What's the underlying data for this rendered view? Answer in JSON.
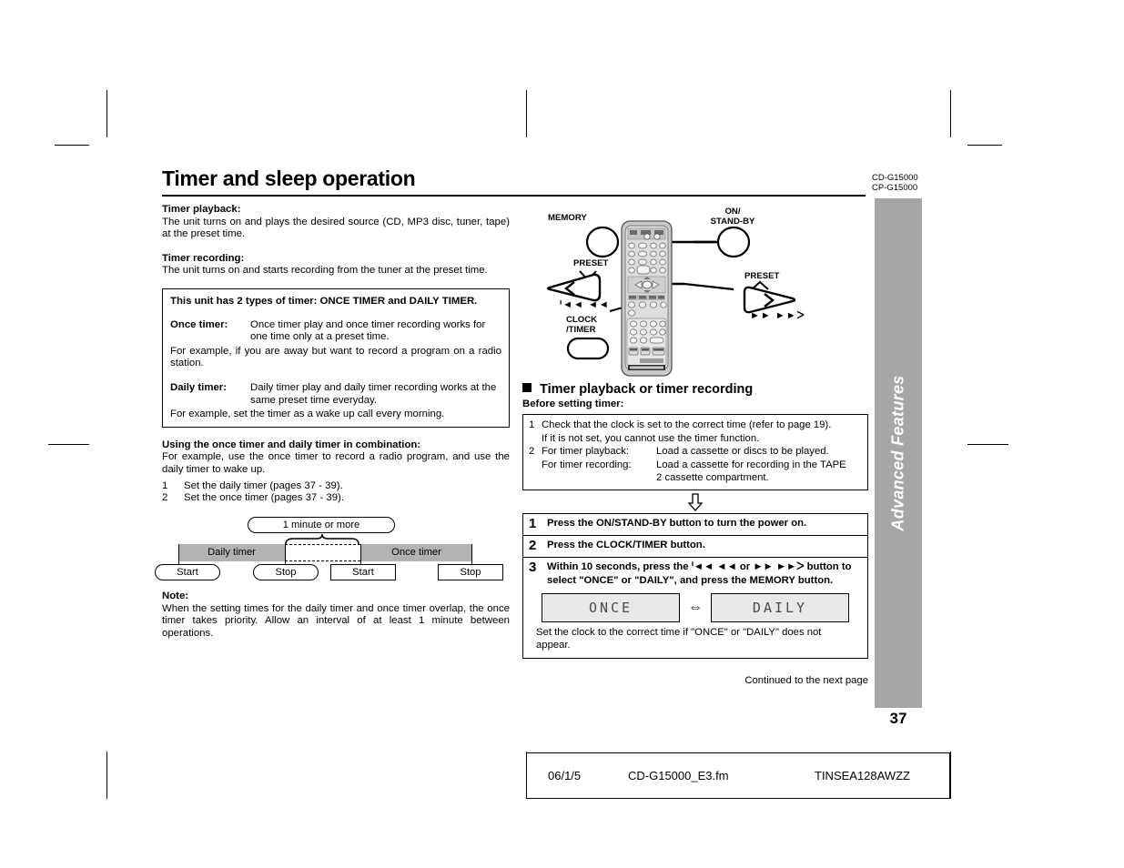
{
  "header": {
    "title": "Timer and sleep operation",
    "model_lines": [
      "CD-G15000",
      "CP-G15000"
    ]
  },
  "left": {
    "timer_playback_head": "Timer playback:",
    "timer_playback_body": "The unit turns on and plays the desired source (CD, MP3 disc, tuner, tape) at the preset time.",
    "timer_recording_head": "Timer recording:",
    "timer_recording_body": "The unit turns on and starts recording from the tuner at the preset time.",
    "panel": {
      "heading": "This unit has 2 types of timer: ONCE TIMER and DAILY TIMER.",
      "once_term": "Once timer:",
      "once_body": "Once timer play and once timer recording works for one time only at a preset time.",
      "once_example": "For example, if you are away but want to record a program on a radio station.",
      "daily_term": "Daily timer:",
      "daily_body": "Daily timer play and daily timer recording works at the same preset time everyday.",
      "daily_example": "For example, set the timer as a wake up call every morning."
    },
    "combination": {
      "heading": "Using the once timer and daily timer in combination:",
      "body": "For example, use the once timer to record a radio program, and use the daily timer to wake up.",
      "items": [
        {
          "n": "1",
          "text": "Set the daily timer (pages 37 - 39)."
        },
        {
          "n": "2",
          "text": "Set the once timer (pages 37 - 39)."
        }
      ]
    },
    "timeline": {
      "gap_label": "1 minute or more",
      "daily_label": "Daily timer",
      "once_label": "Once timer",
      "daily_start": "Start",
      "daily_stop": "Stop",
      "once_start": "Start",
      "once_stop": "Stop"
    },
    "note": {
      "heading": "Note:",
      "body": "When the setting times for the daily timer and once timer overlap, the once timer takes priority. Allow an interval of at least 1 minute between operations."
    }
  },
  "right": {
    "remote_labels": {
      "memory": "MEMORY",
      "on_standby_line1": "ON/",
      "on_standby_line2": "STAND-BY",
      "preset_left": "PRESET",
      "preset_right": "PRESET",
      "clock_line1": "CLOCK",
      "clock_line2": "/TIMER",
      "skip_back": "ᑊ◄◄  ◄◄",
      "skip_fwd": "►►  ►►ᐳ"
    },
    "section_heading": "Timer playback or timer recording",
    "before_head": "Before setting timer:",
    "before_box": {
      "row1_n": "1",
      "row1_text": "Check that the clock is set to the correct time (refer to page 19).",
      "row1b_text": "If it is not set, you cannot use the timer function.",
      "row2_n": "2",
      "row2_label": "For timer playback:",
      "row2_text": "Load a cassette or discs to be played.",
      "row3_label": "For timer recording:",
      "row3_text": "Load a cassette for recording in the TAPE",
      "row3b_text": "2 cassette compartment."
    },
    "steps": [
      {
        "num": "1",
        "text": "Press the ON/STAND-BY button to turn the power on."
      },
      {
        "num": "2",
        "text": "Press the CLOCK/TIMER button."
      },
      {
        "num": "3",
        "text": "Within 10 seconds, press the ᑊ◄◄ ◄◄ or ►► ►►ᐳ button to select \"ONCE\" or \"DAILY\", and press the MEMORY button."
      }
    ],
    "lcd_left": "ONCE",
    "lcd_right": "DAILY",
    "lcd_arrow": "⇔",
    "lcd_note": "Set the clock to the correct time if \"ONCE\" or \"DAILY\" does not appear.",
    "continued": "Continued to the next page"
  },
  "sidebar": {
    "label": "Advanced Features",
    "page_number": "37",
    "bg_color": "#a6a6a6"
  },
  "footer": {
    "date": "06/1/5",
    "filename": "CD-G15000_E3.fm",
    "code": "TINSEA128AWZZ"
  },
  "colors": {
    "gray_bar": "#b2b2b2",
    "sidebar_gray": "#a6a6a6",
    "lcd_bg": "#e9e9e9"
  }
}
